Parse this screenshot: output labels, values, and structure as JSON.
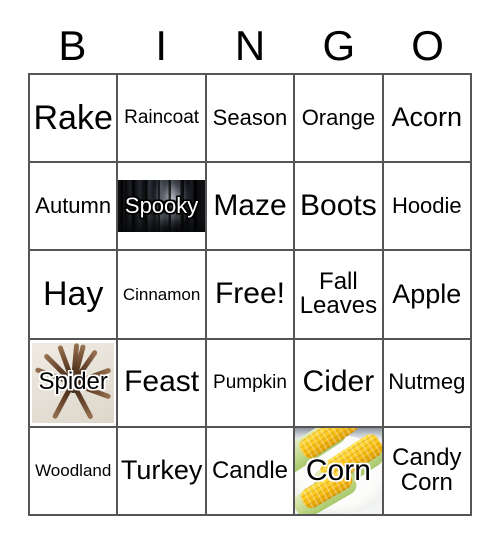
{
  "card": {
    "title": "BINGO Card",
    "columns": [
      "B",
      "I",
      "N",
      "G",
      "O"
    ],
    "grid_rows": 5,
    "grid_cols": 5,
    "border_color": "#555555",
    "background_color": "#ffffff",
    "text_color": "#000000"
  },
  "header": {
    "letters": [
      {
        "label": "B"
      },
      {
        "label": "I"
      },
      {
        "label": "N"
      },
      {
        "label": "G"
      },
      {
        "label": "O"
      }
    ]
  },
  "cells": [
    {
      "label": "Rake",
      "row": 1,
      "col": 1,
      "type": "text",
      "size": "fs-34"
    },
    {
      "label": "Raincoat",
      "row": 1,
      "col": 2,
      "type": "text",
      "size": "fs-19"
    },
    {
      "label": "Season",
      "row": 1,
      "col": 3,
      "type": "text",
      "size": "fs-22"
    },
    {
      "label": "Orange",
      "row": 1,
      "col": 4,
      "type": "text",
      "size": "fs-22"
    },
    {
      "label": "Acorn",
      "row": 1,
      "col": 5,
      "type": "text",
      "size": "fs-27"
    },
    {
      "label": "Autumn",
      "row": 2,
      "col": 1,
      "type": "text",
      "size": "fs-22"
    },
    {
      "label": "Spooky",
      "row": 2,
      "col": 2,
      "type": "image",
      "size": "fs-22",
      "image": "spooky-forest-photo"
    },
    {
      "label": "Maze",
      "row": 2,
      "col": 3,
      "type": "text",
      "size": "fs-30"
    },
    {
      "label": "Boots",
      "row": 2,
      "col": 4,
      "type": "text",
      "size": "fs-30"
    },
    {
      "label": "Hoodie",
      "row": 2,
      "col": 5,
      "type": "text",
      "size": "fs-22"
    },
    {
      "label": "Hay",
      "row": 3,
      "col": 1,
      "type": "text",
      "size": "fs-34"
    },
    {
      "label": "Cinnamon",
      "row": 3,
      "col": 2,
      "type": "text",
      "size": "fs-17"
    },
    {
      "label": "Free!",
      "row": 3,
      "col": 3,
      "type": "text",
      "size": "fs-30"
    },
    {
      "label": "Fall\nLeaves",
      "row": 3,
      "col": 4,
      "type": "text",
      "size": "fs-24"
    },
    {
      "label": "Apple",
      "row": 3,
      "col": 5,
      "type": "text",
      "size": "fs-27"
    },
    {
      "label": "Spider",
      "row": 4,
      "col": 1,
      "type": "image",
      "size": "fs-24",
      "image": "spider-photo"
    },
    {
      "label": "Feast",
      "row": 4,
      "col": 2,
      "type": "text",
      "size": "fs-30"
    },
    {
      "label": "Pumpkin",
      "row": 4,
      "col": 3,
      "type": "text",
      "size": "fs-19"
    },
    {
      "label": "Cider",
      "row": 4,
      "col": 4,
      "type": "text",
      "size": "fs-30"
    },
    {
      "label": "Nutmeg",
      "row": 4,
      "col": 5,
      "type": "text",
      "size": "fs-22"
    },
    {
      "label": "Woodland",
      "row": 5,
      "col": 1,
      "type": "text",
      "size": "fs-17"
    },
    {
      "label": "Turkey",
      "row": 5,
      "col": 2,
      "type": "text",
      "size": "fs-27"
    },
    {
      "label": "Candle",
      "row": 5,
      "col": 3,
      "type": "text",
      "size": "fs-24"
    },
    {
      "label": "Corn",
      "row": 5,
      "col": 4,
      "type": "image",
      "size": "fs-30",
      "image": "corn-photo"
    },
    {
      "label": "Candy\nCorn",
      "row": 5,
      "col": 5,
      "type": "text",
      "size": "fs-24"
    }
  ],
  "free_space": {
    "label": "Free!",
    "position": "center"
  }
}
